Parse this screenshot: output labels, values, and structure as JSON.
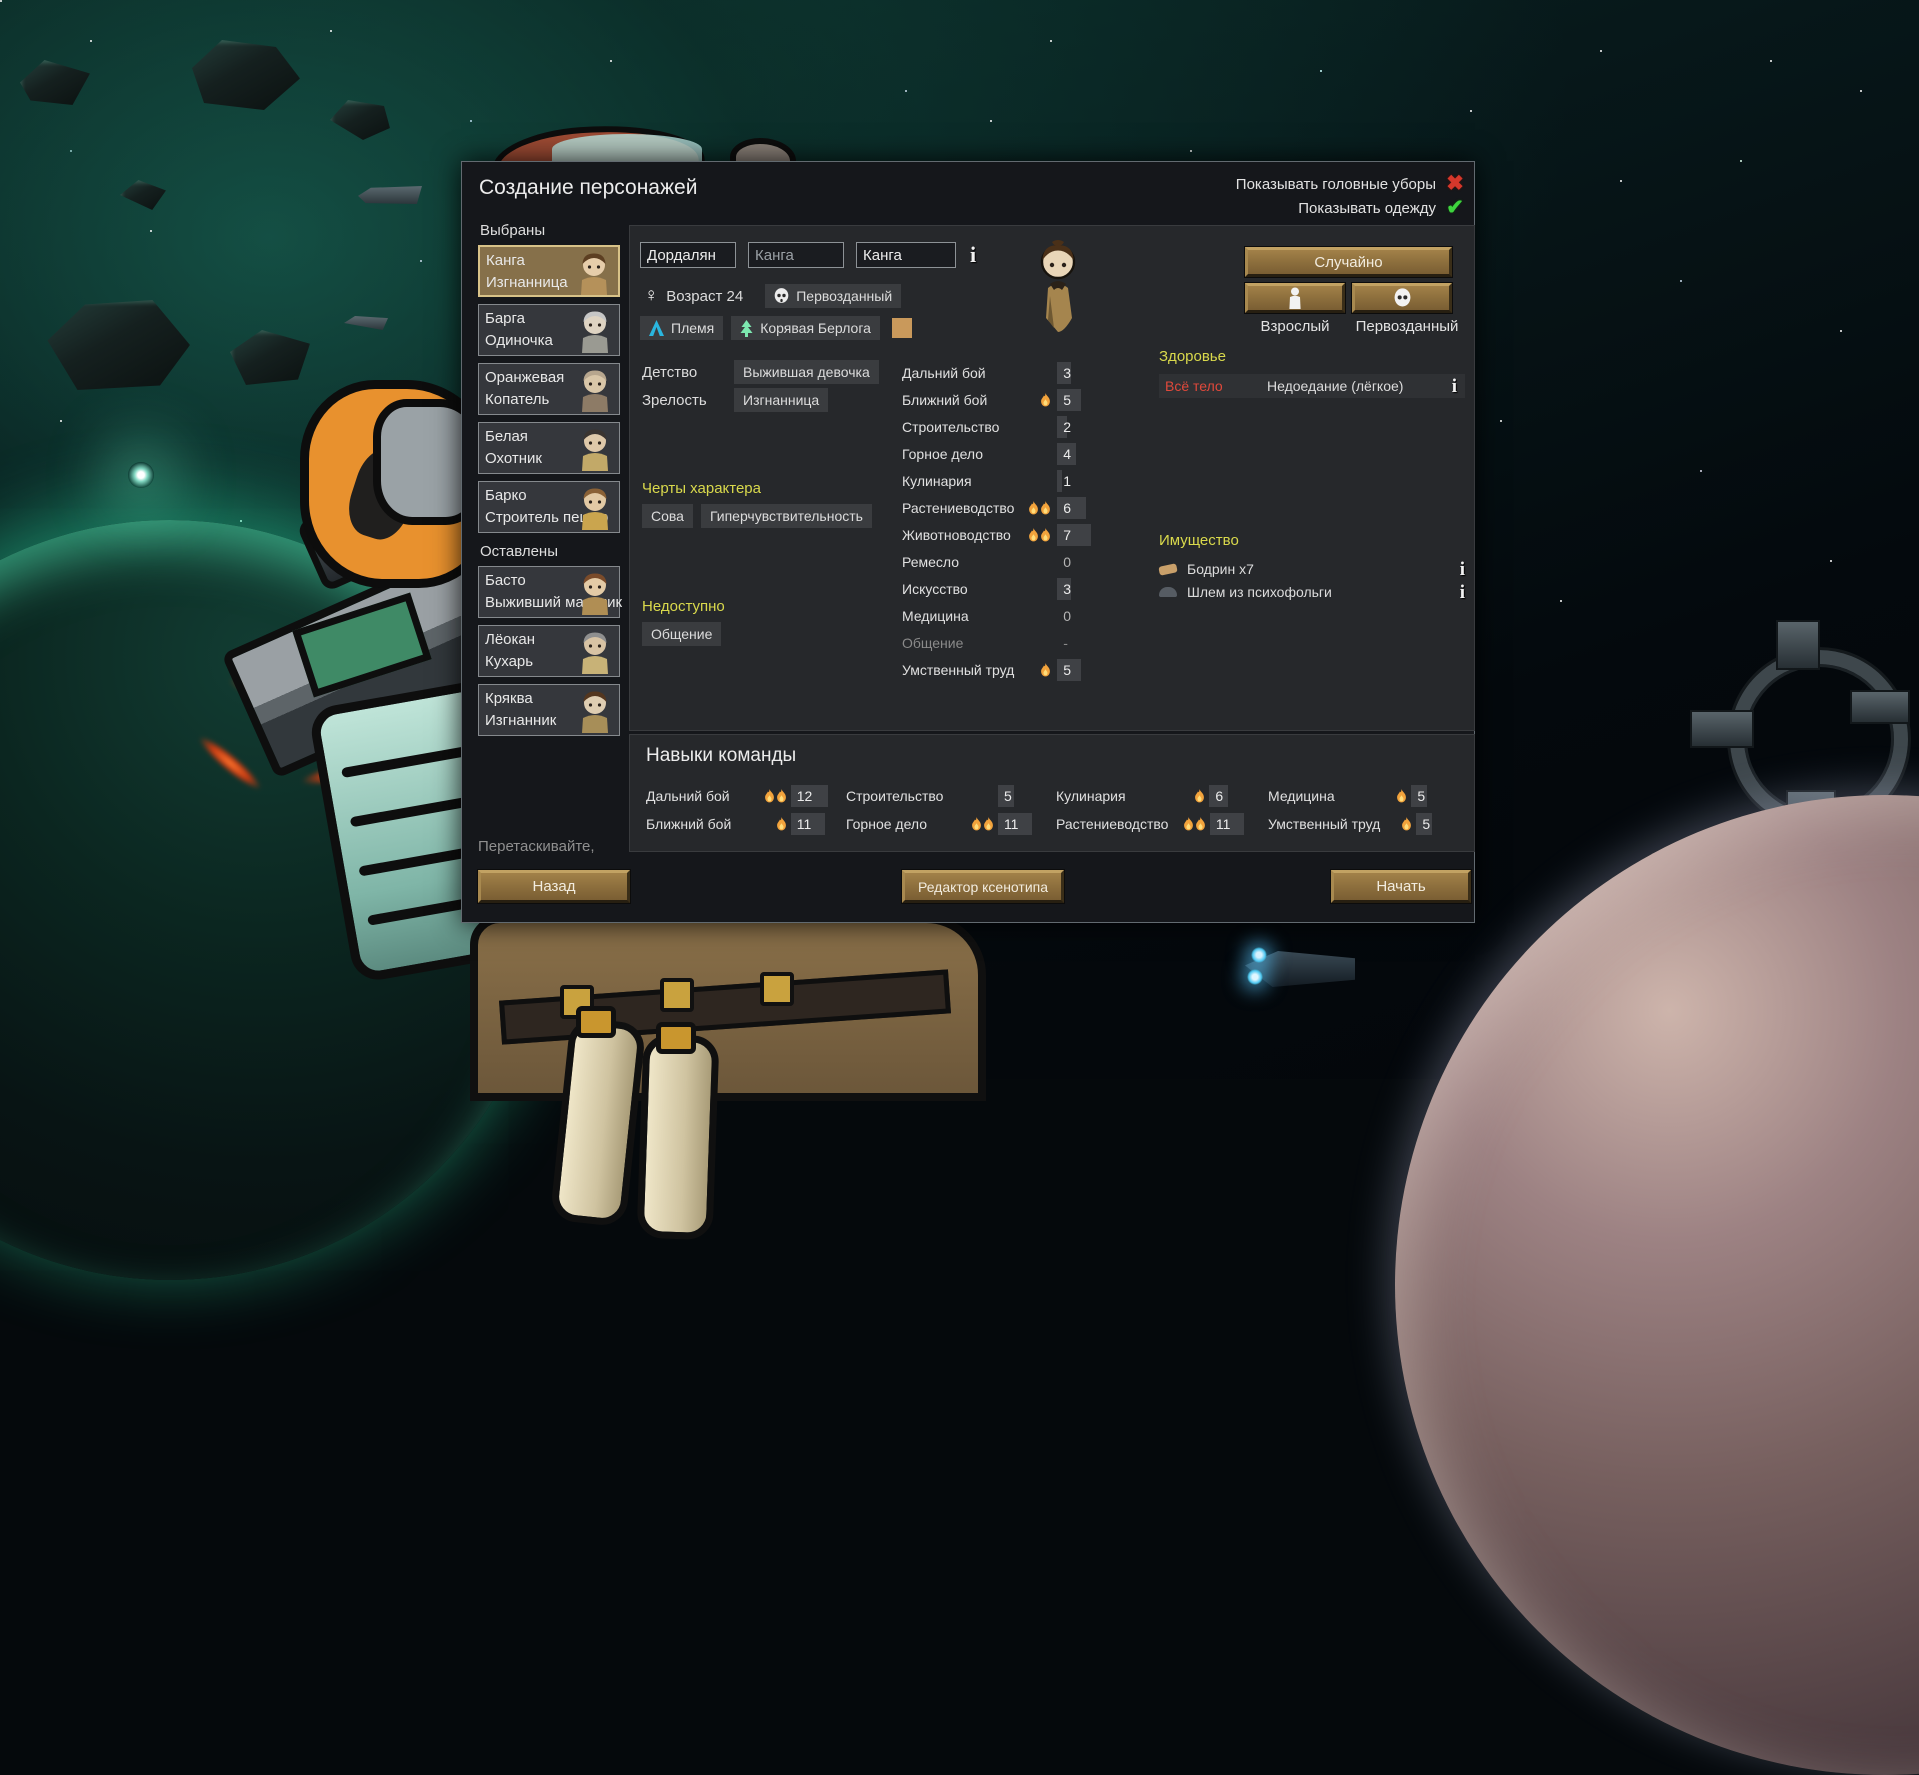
{
  "window": {
    "title": "Создание персонажей"
  },
  "toggles": [
    {
      "label": "Показывать головные уборы",
      "on": false
    },
    {
      "label": "Показывать одежду",
      "on": true
    }
  ],
  "roster": {
    "selected_header": "Выбраны",
    "left_header": "Оставлены",
    "drag_hint": "Перетаскивайте,",
    "selected": [
      {
        "name": "Канга",
        "role": "Изгнанница",
        "active": true,
        "hair": "#5d3f22",
        "cloth": "#b5915a",
        "skin": "#e6cdaa"
      },
      {
        "name": "Барга",
        "role": "Одиночка",
        "active": false,
        "hair": "#c6c6c6",
        "cloth": "#9a9a92",
        "skin": "#ded3c2"
      },
      {
        "name": "Оранжевая",
        "role": "Копатель",
        "active": false,
        "hair": "#b7a68e",
        "cloth": "#8d7b66",
        "skin": "#d9c6a8"
      },
      {
        "name": "Белая",
        "role": "Охотник",
        "active": false,
        "hair": "#3a3430",
        "cloth": "#c2a968",
        "skin": "#dec8a9"
      },
      {
        "name": "Барко",
        "role": "Строитель пещер",
        "active": false,
        "hair": "#8a6136",
        "cloth": "#caa54e",
        "skin": "#e2c9a4"
      }
    ],
    "left": [
      {
        "name": "Басто",
        "role": "Выживший мальчик",
        "active": false,
        "hair": "#7a4b2a",
        "cloth": "#b08e54",
        "skin": "#e4cba6"
      },
      {
        "name": "Лёокан",
        "role": "Кухарь",
        "active": false,
        "hair": "#8f8f8f",
        "cloth": "#c8b277",
        "skin": "#d8c3a4"
      },
      {
        "name": "Кряква",
        "role": "Изгнанник",
        "active": false,
        "hair": "#53361f",
        "cloth": "#a78e58",
        "skin": "#decdb2"
      }
    ]
  },
  "character": {
    "first_name": "Дордалян",
    "nick_name": "Канга",
    "last_name": "Канга",
    "age_label": "Возраст 24",
    "xenotype_chip": "Первозданный",
    "faction_chip": "Племя",
    "ideoligion_chip": "Корявая Берлога",
    "favorite_color": "#c9995b",
    "childhood_label": "Детство",
    "childhood": "Выжившая девочка",
    "adulthood_label": "Зрелость",
    "adulthood": "Изгнанница",
    "traits_header": "Черты характера",
    "traits": [
      "Сова",
      "Гиперчувствительность"
    ],
    "incapable_header": "Недоступно",
    "incapable": [
      "Общение"
    ],
    "skills": [
      {
        "name": "Дальний бой",
        "value": 3,
        "passion": "none"
      },
      {
        "name": "Ближний бой",
        "value": 5,
        "passion": "minor"
      },
      {
        "name": "Строительство",
        "value": 2,
        "passion": "none"
      },
      {
        "name": "Горное дело",
        "value": 4,
        "passion": "none"
      },
      {
        "name": "Кулинария",
        "value": 1,
        "passion": "none"
      },
      {
        "name": "Растениеводство",
        "value": 6,
        "passion": "major"
      },
      {
        "name": "Животноводство",
        "value": 7,
        "passion": "major"
      },
      {
        "name": "Ремесло",
        "value": 0,
        "passion": "none"
      },
      {
        "name": "Искусство",
        "value": 3,
        "passion": "none"
      },
      {
        "name": "Медицина",
        "value": 0,
        "passion": "none"
      },
      {
        "name": "Общение",
        "value": "-",
        "passion": "none",
        "disabled": true
      },
      {
        "name": "Умственный труд",
        "value": 5,
        "passion": "minor"
      }
    ],
    "random_button": "Случайно",
    "body_type_label": "Взрослый",
    "xenotype_button_label": "Первозданный",
    "health": {
      "header": "Здоровье",
      "part": "Всё тело",
      "condition": "Недоедание (лёгкое)"
    },
    "possessions": {
      "header": "Имущество",
      "items": [
        "Бодрин x7",
        "Шлем из психофольги"
      ]
    }
  },
  "team": {
    "header": "Навыки команды",
    "skills": [
      {
        "name": "Дальний бой",
        "value": 12,
        "passion": "major"
      },
      {
        "name": "Ближний бой",
        "value": 11,
        "passion": "minor"
      },
      {
        "name": "Строительство",
        "value": 5,
        "passion": "none"
      },
      {
        "name": "Горное дело",
        "value": 11,
        "passion": "major"
      },
      {
        "name": "Кулинария",
        "value": 6,
        "passion": "minor"
      },
      {
        "name": "Растениеводство",
        "value": 11,
        "passion": "major"
      },
      {
        "name": "Медицина",
        "value": 5,
        "passion": "minor"
      },
      {
        "name": "Умственный труд",
        "value": 5,
        "passion": "minor"
      }
    ]
  },
  "footer": {
    "back": "Назад",
    "xenotype_editor": "Редактор ксенотипа",
    "start": "Начать"
  },
  "colors": {
    "header_yellow": "#d9d94c",
    "bad_red": "#e0493b",
    "check_green": "#3ed43e",
    "cross_red": "#d6372b",
    "button_brown": "#8d6f3d",
    "passion_fire": "#f2a33c",
    "favorite_swatch": "#c9995b"
  }
}
